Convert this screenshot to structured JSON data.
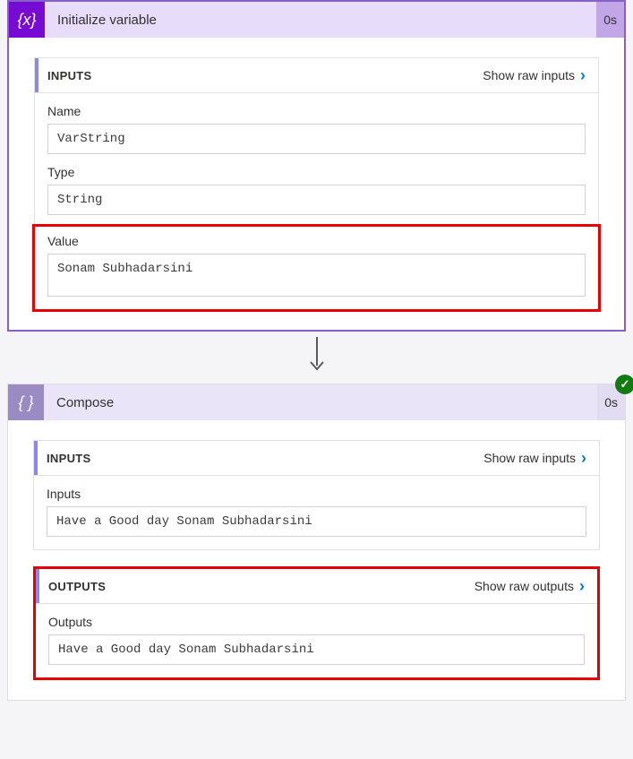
{
  "init": {
    "title": "Initialize variable",
    "duration": "0s",
    "inputs_label": "INPUTS",
    "show_raw_inputs": "Show raw inputs",
    "name_label": "Name",
    "name_value": "VarString",
    "type_label": "Type",
    "type_value": "String",
    "value_label": "Value",
    "value_value": "Sonam Subhadarsini"
  },
  "compose": {
    "title": "Compose",
    "duration": "0s",
    "inputs_label": "INPUTS",
    "show_raw_inputs": "Show raw inputs",
    "inputs_field_label": "Inputs",
    "inputs_field_value": "Have a Good day Sonam Subhadarsini",
    "outputs_label": "OUTPUTS",
    "show_raw_outputs": "Show raw outputs",
    "outputs_field_label": "Outputs",
    "outputs_field_value": "Have a Good day Sonam Subhadarsini"
  }
}
